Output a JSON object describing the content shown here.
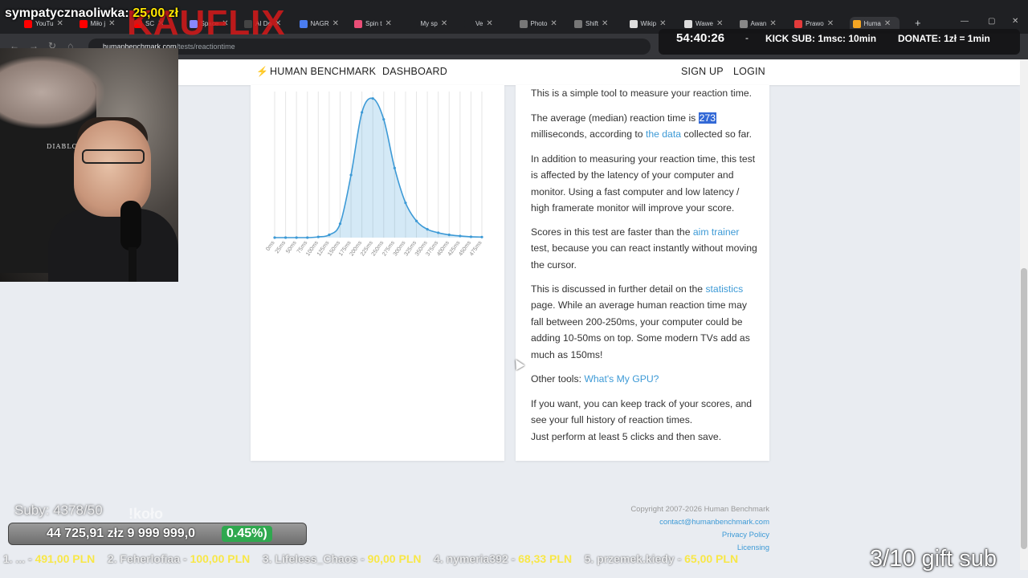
{
  "browser": {
    "tabs": [
      {
        "label": "YouTu",
        "color": "#ff0000"
      },
      {
        "label": "Miło j",
        "color": "#ff0000"
      },
      {
        "label": "SC",
        "color": "#ff0000"
      },
      {
        "label": "Space",
        "color": "#8888ff"
      },
      {
        "label": "AI Do",
        "color": "#444444"
      },
      {
        "label": "NAGR",
        "color": "#4a7cf0"
      },
      {
        "label": "Spin t",
        "color": "#e94e77"
      },
      {
        "label": "My sp",
        "color": "#1f2023"
      },
      {
        "label": "Ve",
        "color": "#1f2023"
      },
      {
        "label": "Photo",
        "color": "#777777"
      },
      {
        "label": "Shift",
        "color": "#777777"
      },
      {
        "label": "Wikip",
        "color": "#dddddd"
      },
      {
        "label": "Wawe",
        "color": "#dddddd"
      },
      {
        "label": "Awan",
        "color": "#888888"
      },
      {
        "label": "Prawo",
        "color": "#e33b3b"
      },
      {
        "label": "Huma",
        "color": "#f5a623"
      }
    ],
    "close_glyph": "✕",
    "new_tab": "+",
    "url_host": "humanbenchmark.com",
    "url_path": "/tests/reactiontime",
    "back": "←",
    "forward": "→",
    "reload": "↻",
    "home": "⌂"
  },
  "site": {
    "brand": "HUMAN BENCHMARK",
    "bolt": "⚡",
    "nav": {
      "dashboard": "DASHBOARD",
      "signup": "SIGN UP",
      "login": "LOGIN"
    }
  },
  "chart_data": {
    "type": "area",
    "categories": [
      "0ms",
      "25ms",
      "50ms",
      "75ms",
      "100ms",
      "125ms",
      "150ms",
      "175ms",
      "200ms",
      "225ms",
      "250ms",
      "275ms",
      "300ms",
      "325ms",
      "350ms",
      "375ms",
      "400ms",
      "425ms",
      "450ms",
      "475ms"
    ],
    "series": [
      {
        "values": [
          0.0,
          0.0,
          0.0,
          0.0,
          0.005,
          0.02,
          0.1,
          0.45,
          0.9,
          1.0,
          0.85,
          0.5,
          0.25,
          0.12,
          0.06,
          0.035,
          0.02,
          0.012,
          0.006,
          0.004
        ],
        "color": "#3d9ad6"
      }
    ],
    "ylim": [
      0,
      1.05
    ],
    "grid": true,
    "xlabel": "",
    "ylabel": ""
  },
  "content": {
    "p1": "This is a simple tool to measure your reaction time.",
    "p2_a": "The average (median) reaction time is ",
    "p2_median": "273",
    "p2_b": " milliseconds, according to ",
    "p2_link": "the data",
    "p2_c": " collected so far.",
    "p3": "In addition to measuring your reaction time, this test is affected by the latency of your computer and monitor. Using a fast computer and low latency / high framerate monitor will improve your score.",
    "p4_a": "Scores in this test are faster than the ",
    "p4_link": "aim trainer",
    "p4_b": " test, because you can react instantly without moving the cursor.",
    "p5_a": "This is discussed in further detail on the ",
    "p5_link": "statistics",
    "p5_b": " page. While an average human reaction time may fall between 200-250ms, your computer could be adding 10-50ms on top. Some modern TVs add as much as 150ms!",
    "p6_a": "Other tools: ",
    "p6_link": "What's My GPU?",
    "p7": "If you want, you can keep track of your scores, and see your full history of reaction times.",
    "p8": "Just perform at least 5 clicks and then save."
  },
  "footer": {
    "copyright": "Copyright 2007-2026 Human Benchmark",
    "email": "contact@humanbenchmark.com",
    "privacy": "Privacy Policy",
    "licensing": "Licensing"
  },
  "overlay": {
    "donor_name": "sympatycznaoliwka:",
    "donor_amount": "25,00 zł",
    "brand_text": "KAUFLIX",
    "timer": "54:40:26",
    "dash": "-",
    "kick_sub": "KICK SUB: 1msc: 10min",
    "donate": "DONATE: 1zł = 1min",
    "subs": "Suby: 4378/50",
    "kolo": "!koło",
    "goal_text": "44 725,91 złz  9 999 999,0",
    "goal_pct": "0.45%)",
    "ticker": [
      {
        "n": "1. ...",
        "v": "491,00 PLN"
      },
      {
        "n": "2. Feherlofiaa",
        "v": "100,00 PLN"
      },
      {
        "n": "3. Lifeless_Chaos",
        "v": "90,00 PLN"
      },
      {
        "n": "4. nymeria392",
        "v": "68,33 PLN"
      },
      {
        "n": "5. przemek.kiedy",
        "v": "65,00 PLN"
      }
    ],
    "gift_sub": "3/10 gift sub",
    "webcam_shirt": "DIABLO"
  }
}
